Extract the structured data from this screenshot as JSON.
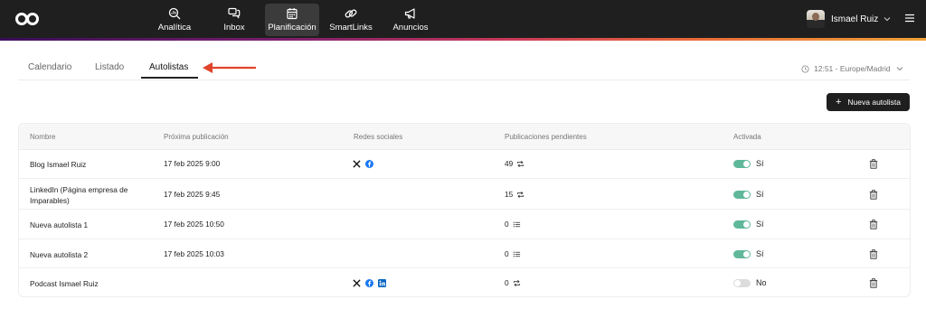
{
  "nav": {
    "items": [
      {
        "label": "Analítica",
        "icon": "analytics-search-icon"
      },
      {
        "label": "Inbox",
        "icon": "chat-bubbles-icon"
      },
      {
        "label": "Planificación",
        "icon": "calendar-icon",
        "active": true
      },
      {
        "label": "SmartLinks",
        "icon": "link-icon"
      },
      {
        "label": "Anuncios",
        "icon": "megaphone-icon"
      }
    ],
    "user_name": "Ismael Ruiz"
  },
  "tabs": [
    {
      "label": "Calendario"
    },
    {
      "label": "Listado"
    },
    {
      "label": "Autolistas",
      "active": true
    }
  ],
  "timezone": "12:51 - Europe/Madrid",
  "new_button": "Nueva autolista",
  "table": {
    "headers": [
      "Nombre",
      "Próxima publicación",
      "Redes sociales",
      "Publicaciones pendientes",
      "Activada"
    ],
    "rows": [
      {
        "name": "Blog Ismael Ruiz",
        "next": "17 feb 2025 9:00",
        "socials": [
          "x-icon",
          "facebook-icon"
        ],
        "pending": "49",
        "pending_icon": "repeat-icon",
        "active": true,
        "active_label": "Sí"
      },
      {
        "name": "LinkedIn (Página empresa de Imparables)",
        "next": "17 feb 2025 9:45",
        "socials": [],
        "pending": "15",
        "pending_icon": "repeat-icon",
        "active": true,
        "active_label": "Sí"
      },
      {
        "name": "Nueva autolista 1",
        "next": "17 feb 2025 10:50",
        "socials": [],
        "pending": "0",
        "pending_icon": "list-icon",
        "active": true,
        "active_label": "Sí"
      },
      {
        "name": "Nueva autolista 2",
        "next": "17 feb 2025 10:03",
        "socials": [],
        "pending": "0",
        "pending_icon": "list-icon",
        "active": true,
        "active_label": "Sí"
      },
      {
        "name": "Podcast Ismael Ruiz",
        "next": "",
        "socials": [
          "x-icon",
          "facebook-icon",
          "linkedin-icon"
        ],
        "pending": "0",
        "pending_icon": "repeat-icon",
        "active": false,
        "active_label": "No"
      }
    ]
  },
  "colors": {
    "topbar": "#1f1f1f",
    "toggle_on": "#5fb89a",
    "arrow": "#e0442a",
    "facebook": "#1877f2",
    "linkedin": "#0a66c2"
  }
}
